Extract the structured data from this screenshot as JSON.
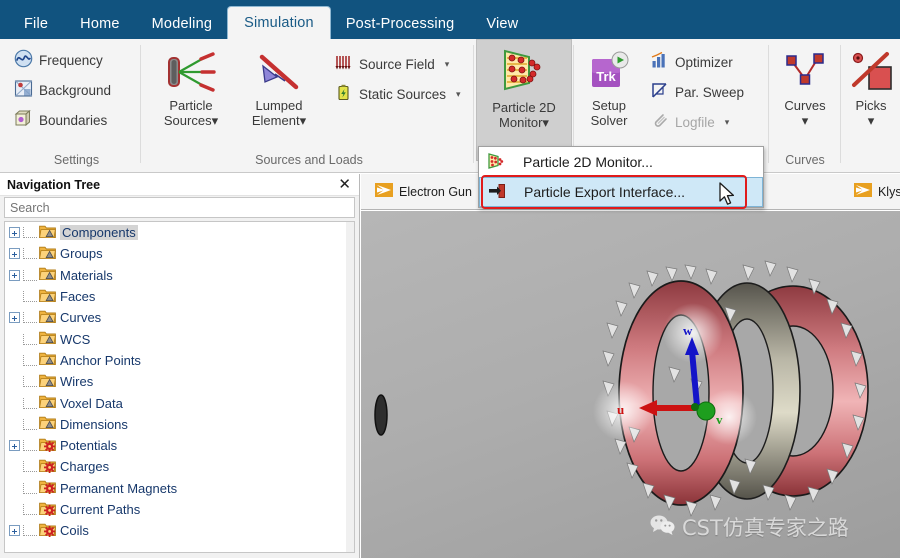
{
  "ribbon": {
    "tabs": [
      {
        "label": "File",
        "active": false
      },
      {
        "label": "Home",
        "active": false
      },
      {
        "label": "Modeling",
        "active": false
      },
      {
        "label": "Simulation",
        "active": true
      },
      {
        "label": "Post-Processing",
        "active": false
      },
      {
        "label": "View",
        "active": false
      }
    ],
    "groups": [
      {
        "label": "Settings",
        "commands": [
          {
            "label": "Frequency",
            "icon": "frequency-icon"
          },
          {
            "label": "Background",
            "icon": "background-icon"
          },
          {
            "label": "Boundaries",
            "icon": "boundaries-icon"
          }
        ]
      },
      {
        "label": "Sources and Loads",
        "commands": [
          {
            "label": "Particle Sources",
            "icon": "particle-sources-icon",
            "caret": true
          },
          {
            "label": "Lumped Element",
            "icon": "lumped-element-icon",
            "caret": true
          },
          {
            "label": "Source Field",
            "icon": "source-field-icon",
            "caret": true
          },
          {
            "label": "Static Sources",
            "icon": "static-sources-icon",
            "caret": true
          }
        ]
      },
      {
        "label": "",
        "commands": [
          {
            "label": "Particle 2D Monitor",
            "icon": "particle-2d-monitor-icon",
            "caret": true,
            "selected": true
          }
        ]
      },
      {
        "label": "",
        "commands": [
          {
            "label": "Setup Solver",
            "icon": "setup-solver-icon"
          },
          {
            "label": "Optimizer",
            "icon": "optimizer-icon"
          },
          {
            "label": "Par. Sweep",
            "icon": "par-sweep-icon"
          },
          {
            "label": "Logfile",
            "icon": "logfile-icon",
            "caret": true,
            "disabled": true
          }
        ]
      },
      {
        "label": "Curves",
        "commands": [
          {
            "label": "Curves",
            "icon": "curves-icon",
            "caret": true
          }
        ]
      },
      {
        "label": "",
        "commands": [
          {
            "label": "Picks",
            "icon": "picks-icon",
            "caret": true
          }
        ]
      }
    ],
    "labels": {
      "settings": "Settings",
      "sources_and_loads": "Sources and Loads",
      "curves": "Curves"
    },
    "big": {
      "particle_sources_l1": "Particle",
      "particle_sources_l2": "Sources",
      "lumped_element_l1": "Lumped",
      "lumped_element_l2": "Element",
      "particle_monitor_l1": "Particle 2D",
      "particle_monitor_l2": "Monitor",
      "setup_solver_l1": "Setup",
      "setup_solver_l2": "Solver",
      "curves_l1": "Curves",
      "picks_l1": "Picks"
    },
    "small": {
      "frequency": "Frequency",
      "background": "Background",
      "boundaries": "Boundaries",
      "source_field": "Source Field",
      "static_sources": "Static Sources",
      "optimizer": "Optimizer",
      "par_sweep": "Par. Sweep",
      "logfile": "Logfile"
    }
  },
  "dropdown": {
    "items": [
      {
        "label": "Particle 2D Monitor...",
        "icon": "particle-2d-monitor-icon",
        "highlighted": false
      },
      {
        "label": "Particle Export Interface...",
        "icon": "particle-export-icon",
        "highlighted": true
      }
    ]
  },
  "navigation": {
    "title": "Navigation Tree",
    "close_label": "✕",
    "search_placeholder": "Search",
    "search_value": "",
    "items": [
      {
        "label": "Components",
        "expandable": true,
        "icon": "folder-shape-icon",
        "selected": true
      },
      {
        "label": "Groups",
        "expandable": true,
        "icon": "folder-shape-icon",
        "selected": false
      },
      {
        "label": "Materials",
        "expandable": true,
        "icon": "folder-shape-icon",
        "selected": false
      },
      {
        "label": "Faces",
        "expandable": false,
        "icon": "folder-shape-icon",
        "selected": false
      },
      {
        "label": "Curves",
        "expandable": true,
        "icon": "folder-shape-icon",
        "selected": false
      },
      {
        "label": "WCS",
        "expandable": false,
        "icon": "folder-shape-icon",
        "selected": false
      },
      {
        "label": "Anchor Points",
        "expandable": false,
        "icon": "folder-shape-icon",
        "selected": false
      },
      {
        "label": "Wires",
        "expandable": false,
        "icon": "folder-shape-icon",
        "selected": false
      },
      {
        "label": "Voxel Data",
        "expandable": false,
        "icon": "folder-shape-icon",
        "selected": false
      },
      {
        "label": "Dimensions",
        "expandable": false,
        "icon": "folder-shape-icon",
        "selected": false
      },
      {
        "label": "Potentials",
        "expandable": true,
        "icon": "folder-gear-icon",
        "selected": false
      },
      {
        "label": "Charges",
        "expandable": false,
        "icon": "folder-gear-icon",
        "selected": false
      },
      {
        "label": "Permanent Magnets",
        "expandable": false,
        "icon": "folder-gear-icon",
        "selected": false
      },
      {
        "label": "Current Paths",
        "expandable": false,
        "icon": "folder-gear-icon",
        "selected": false
      },
      {
        "label": "Coils",
        "expandable": true,
        "icon": "folder-gear-icon",
        "selected": false
      }
    ]
  },
  "document_tabs": [
    {
      "label": "Electron Gun",
      "icon": "project-icon"
    },
    {
      "label": "Klystron out",
      "icon": "project-icon"
    }
  ],
  "viewport": {
    "axis_labels": {
      "u": "u",
      "v": "v",
      "w": "w"
    },
    "watermark": "CST仿真专家之路"
  },
  "colors": {
    "ribbon_tab_bar": "#11537f",
    "ribbon_body": "#f4f4f4",
    "highlight_menu": "#cfe8f7",
    "redbox": "#e01b1b",
    "axis_u": "#d22020",
    "axis_v": "#1e9e1e",
    "axis_w": "#1414c8",
    "torus": "#c96a70"
  }
}
